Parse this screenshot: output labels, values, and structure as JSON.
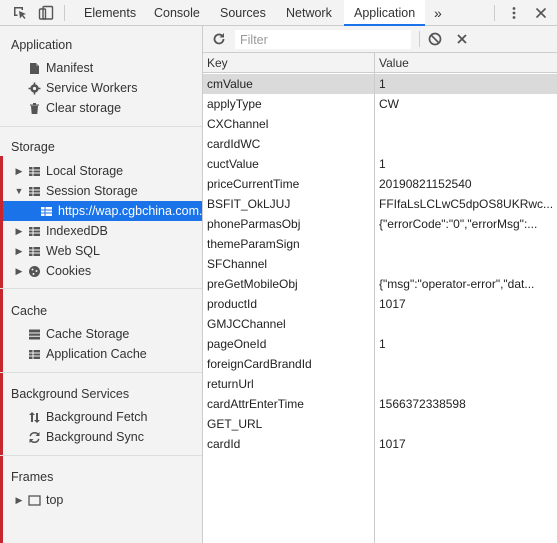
{
  "tabs": [
    {
      "label": "Elements",
      "active": false
    },
    {
      "label": "Console",
      "active": false
    },
    {
      "label": "Sources",
      "active": false
    },
    {
      "label": "Network",
      "active": false
    },
    {
      "label": "Application",
      "active": true
    }
  ],
  "tab_overflow": "»",
  "sidebar": {
    "application_title": "Application",
    "application_items": [
      "Manifest",
      "Service Workers",
      "Clear storage"
    ],
    "storage_title": "Storage",
    "storage_items": [
      "Local Storage",
      "Session Storage",
      "https://wap.cgbchina.com.cn",
      "IndexedDB",
      "Web SQL",
      "Cookies"
    ],
    "cache_title": "Cache",
    "cache_items": [
      "Cache Storage",
      "Application Cache"
    ],
    "bg_title": "Background Services",
    "bg_items": [
      "Background Fetch",
      "Background Sync"
    ],
    "frames_title": "Frames",
    "frames_items": [
      "top"
    ]
  },
  "filter": {
    "placeholder": "Filter"
  },
  "table": {
    "headers": [
      "Key",
      "Value"
    ],
    "rows": [
      {
        "key": "cmValue",
        "value": "1",
        "selected": true
      },
      {
        "key": "applyType",
        "value": "CW"
      },
      {
        "key": "CXChannel",
        "value": ""
      },
      {
        "key": "cardIdWC",
        "value": ""
      },
      {
        "key": "cuctValue",
        "value": "1"
      },
      {
        "key": "priceCurrentTime",
        "value": "20190821152540"
      },
      {
        "key": "BSFIT_OkLJUJ",
        "value": "FFIfaLsLCLwC5dpOS8UKRwc..."
      },
      {
        "key": "phoneParmasObj",
        "value": "{\"errorCode\":\"0\",\"errorMsg\":..."
      },
      {
        "key": "themeParamSign",
        "value": ""
      },
      {
        "key": "SFChannel",
        "value": ""
      },
      {
        "key": "preGetMobileObj",
        "value": "{\"msg\":\"operator-error\",\"dat..."
      },
      {
        "key": "productId",
        "value": "1017"
      },
      {
        "key": "GMJCChannel",
        "value": ""
      },
      {
        "key": "pageOneId",
        "value": "1"
      },
      {
        "key": "foreignCardBrandId",
        "value": ""
      },
      {
        "key": "returnUrl",
        "value": ""
      },
      {
        "key": "cardAttrEnterTime",
        "value": "1566372338598"
      },
      {
        "key": "GET_URL",
        "value": ""
      },
      {
        "key": "cardId",
        "value": "1017"
      }
    ]
  },
  "colors": {
    "accent": "#1a73e8",
    "selected_row": "#dadada",
    "left_accent": "#c8262e"
  }
}
